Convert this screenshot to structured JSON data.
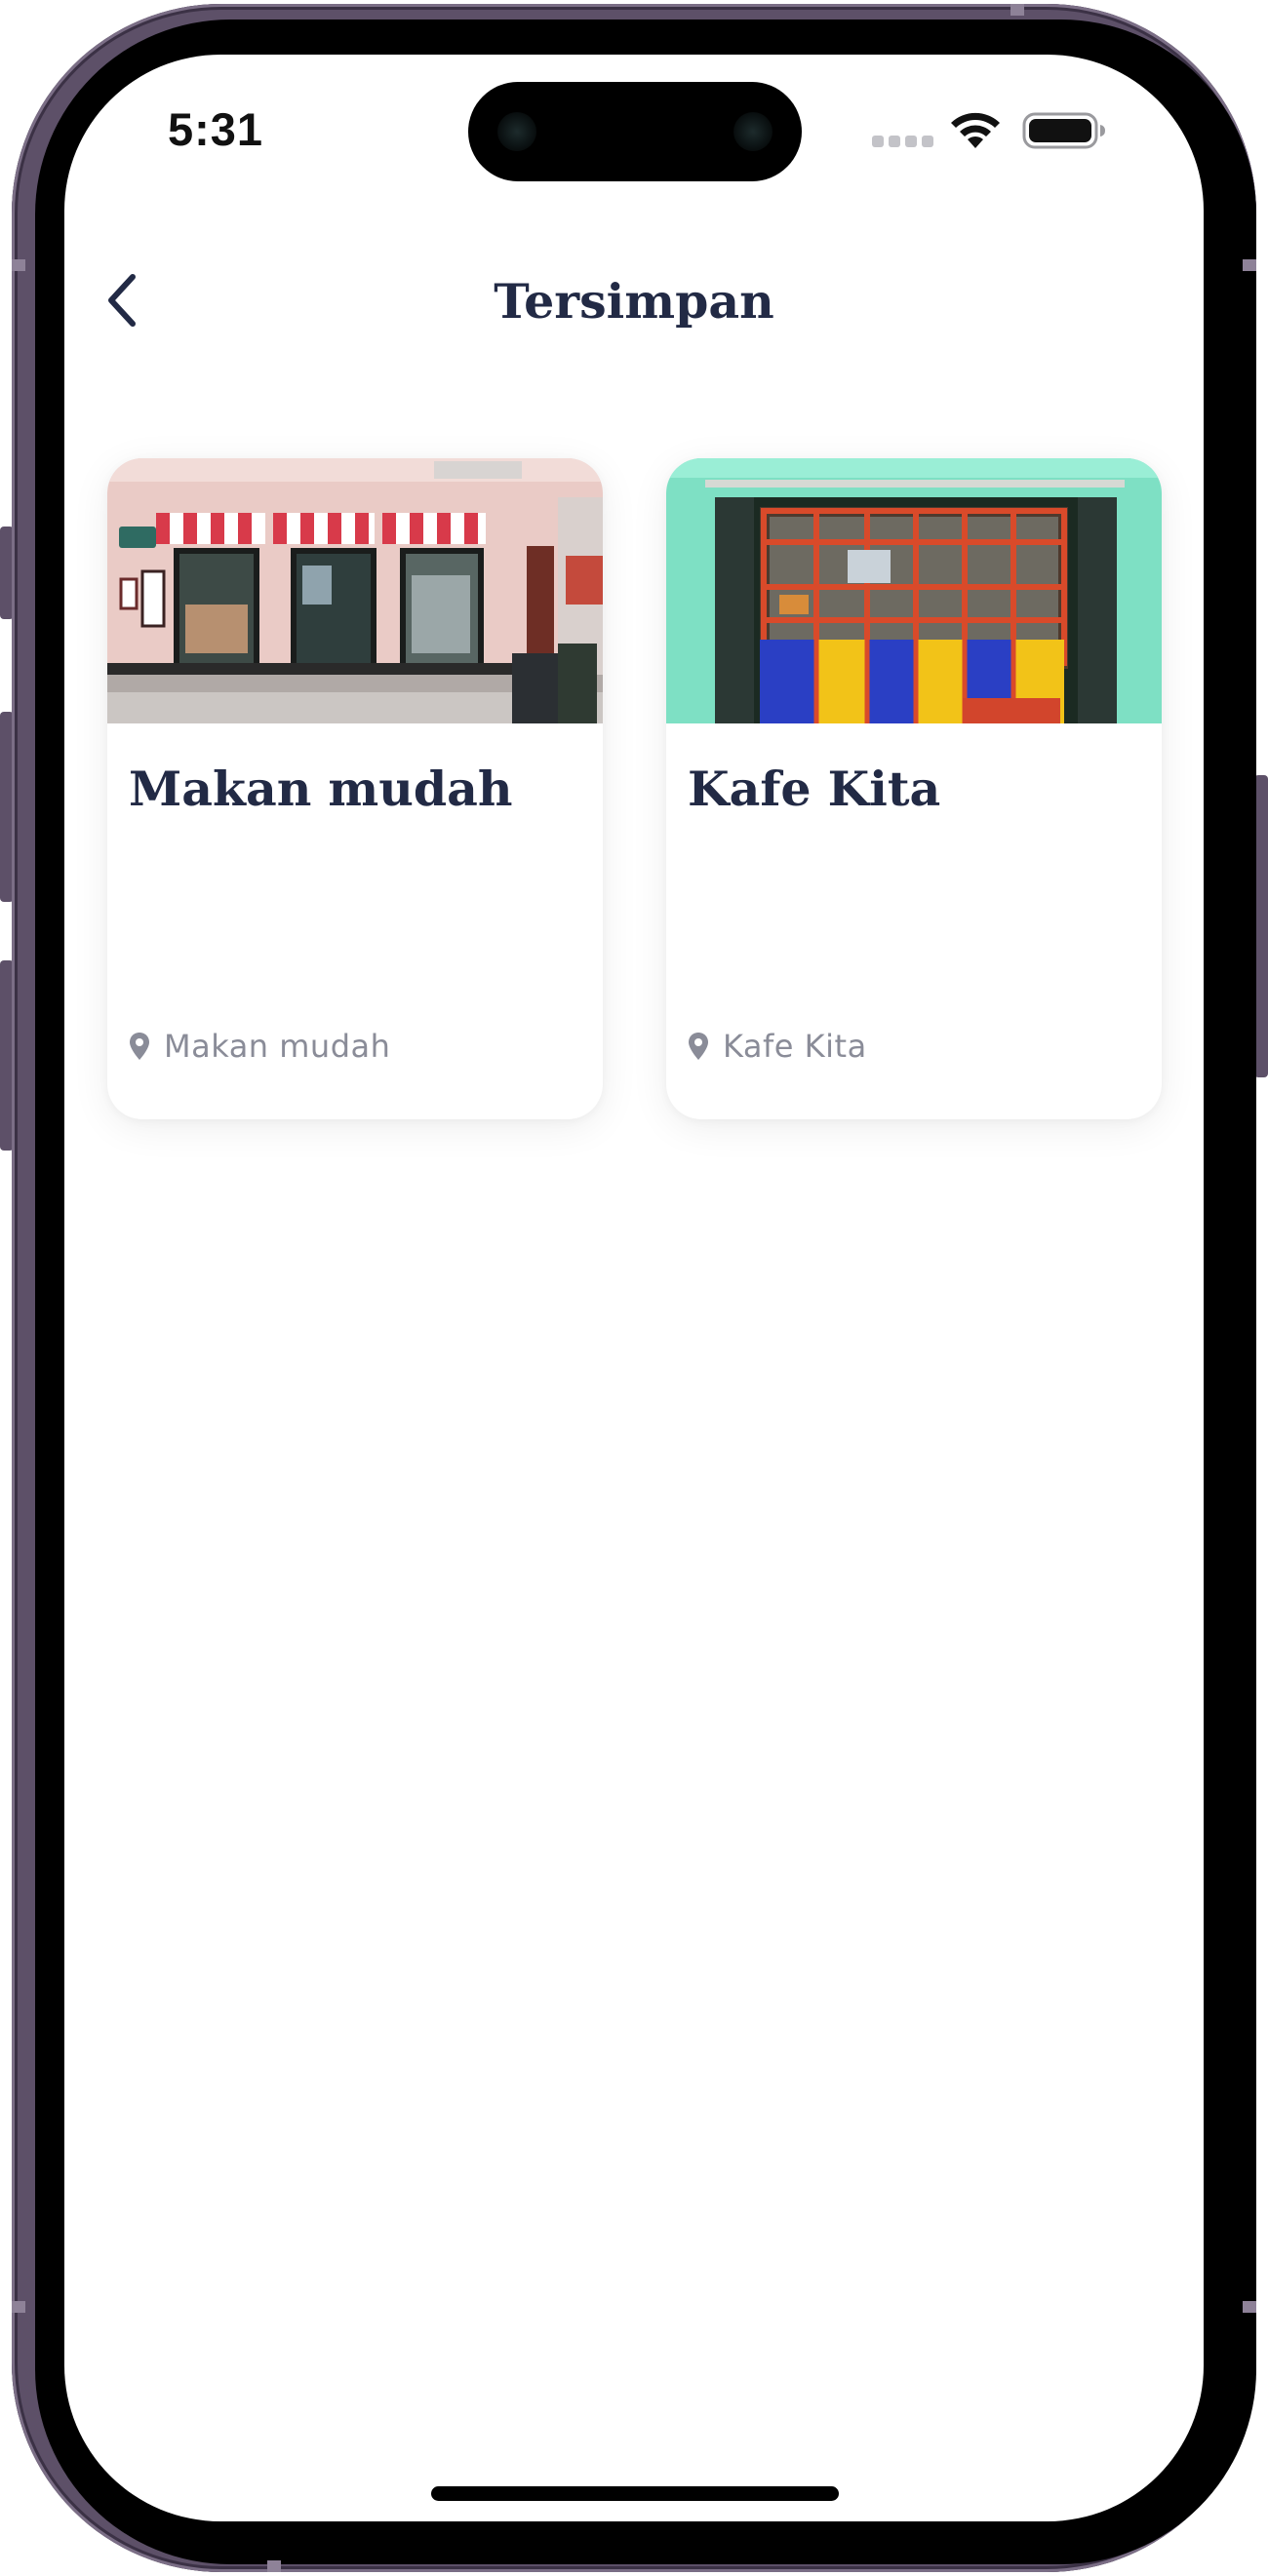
{
  "status_bar": {
    "time": "5:31"
  },
  "header": {
    "back_icon": "chevron-left-icon",
    "title": "Tersimpan"
  },
  "saved_places": [
    {
      "name": "Makan mudah",
      "location": "Makan mudah",
      "image": "storefront-with-striped-awnings"
    },
    {
      "name": "Kafe Kita",
      "location": "Kafe Kita",
      "image": "colorful-kiosk-window"
    }
  ],
  "colors": {
    "title_text": "#222a45",
    "muted_text": "#8a8c98",
    "phone_frame": "#5d5068",
    "screen_background": "#ffffff"
  }
}
